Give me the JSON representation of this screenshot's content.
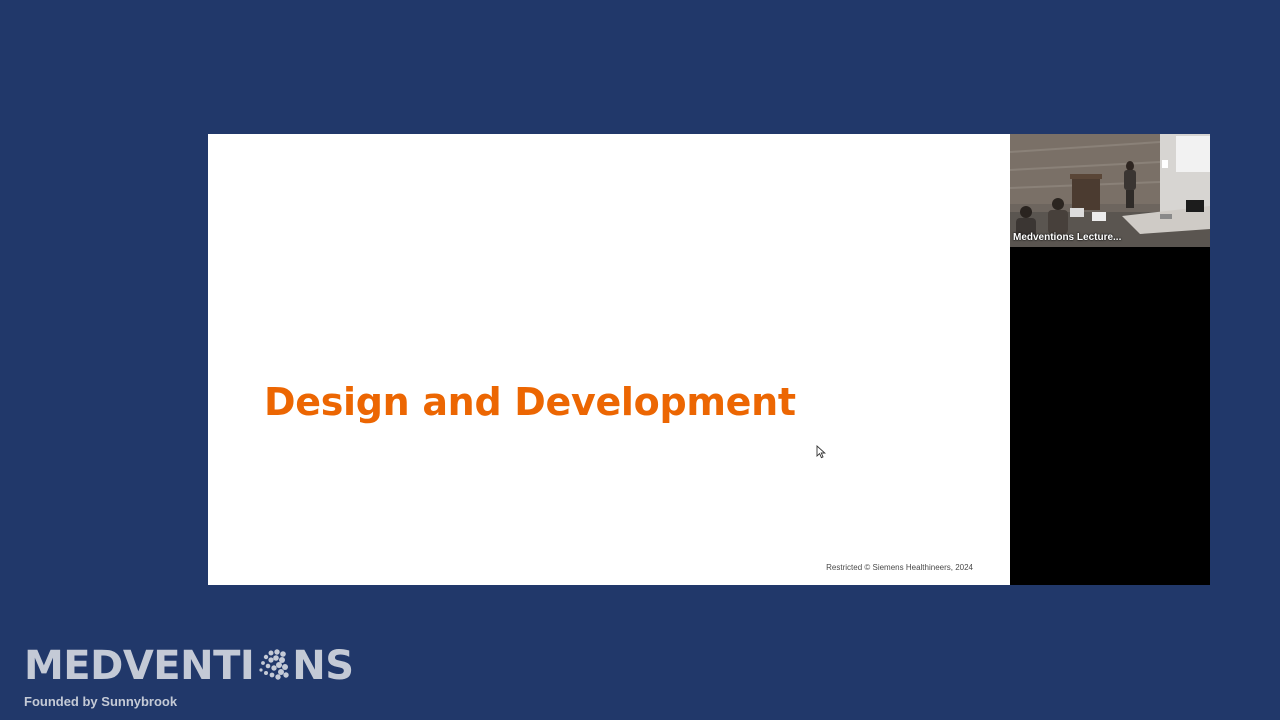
{
  "slide": {
    "title": "Design and Development",
    "footer": "Restricted © Siemens Healthineers, 2024"
  },
  "video_panel": {
    "participant_label": "Medventions Lecture..."
  },
  "brand": {
    "logo_prefix": "MEDVENTI",
    "logo_suffix": "NS",
    "tagline": "Founded by Sunnybrook"
  },
  "colors": {
    "background": "#21386a",
    "title_accent": "#ec6602",
    "slide_background": "#ffffff",
    "panel_background": "#000000"
  },
  "icons": [
    "cursor-arrow-icon",
    "globe-o-icon"
  ]
}
